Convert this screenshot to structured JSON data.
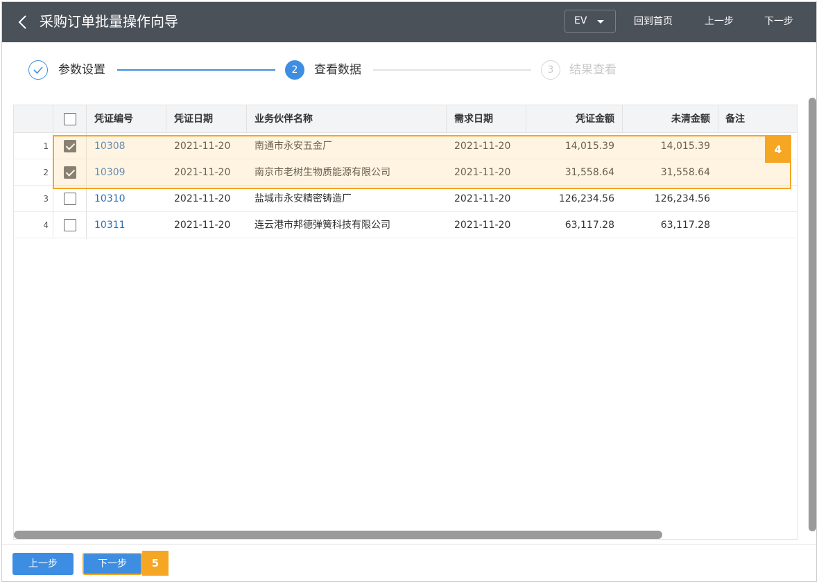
{
  "header": {
    "title": "采购订单批量操作向导",
    "ev_label": "EV",
    "home_link": "回到首页",
    "prev_link": "上一步",
    "next_link": "下一步"
  },
  "stepper": {
    "steps": [
      {
        "number": "",
        "label": "参数设置",
        "state": "done"
      },
      {
        "number": "2",
        "label": "查看数据",
        "state": "active"
      },
      {
        "number": "3",
        "label": "结果查看",
        "state": "pending"
      }
    ]
  },
  "table": {
    "columns": [
      "凭证编号",
      "凭证日期",
      "业务伙伴名称",
      "需求日期",
      "凭证金额",
      "未清金额",
      "备注"
    ],
    "rows": [
      {
        "num": "1",
        "checked": true,
        "voucher": "10308",
        "date": "2021-11-20",
        "partner": "南通市永安五金厂",
        "req_date": "2021-11-20",
        "amount": "14,015.39",
        "open": "14,015.39",
        "note": ""
      },
      {
        "num": "2",
        "checked": true,
        "voucher": "10309",
        "date": "2021-11-20",
        "partner": "南京市老树生物质能源有限公司",
        "req_date": "2021-11-20",
        "amount": "31,558.64",
        "open": "31,558.64",
        "note": ""
      },
      {
        "num": "3",
        "checked": false,
        "voucher": "10310",
        "date": "2021-11-20",
        "partner": "盐城市永安精密铸造厂",
        "req_date": "2021-11-20",
        "amount": "126,234.56",
        "open": "126,234.56",
        "note": ""
      },
      {
        "num": "4",
        "checked": false,
        "voucher": "10311",
        "date": "2021-11-20",
        "partner": "连云港市邦德弹簧科技有限公司",
        "req_date": "2021-11-20",
        "amount": "63,117.28",
        "open": "63,117.28",
        "note": ""
      }
    ]
  },
  "annotations": {
    "rows_badge": "4",
    "next_badge": "5"
  },
  "footer": {
    "prev_button": "上一步",
    "next_button": "下一步"
  },
  "colors": {
    "header_bg": "#4b5159",
    "accent": "#3d8ee2",
    "highlight": "#f5a623"
  }
}
